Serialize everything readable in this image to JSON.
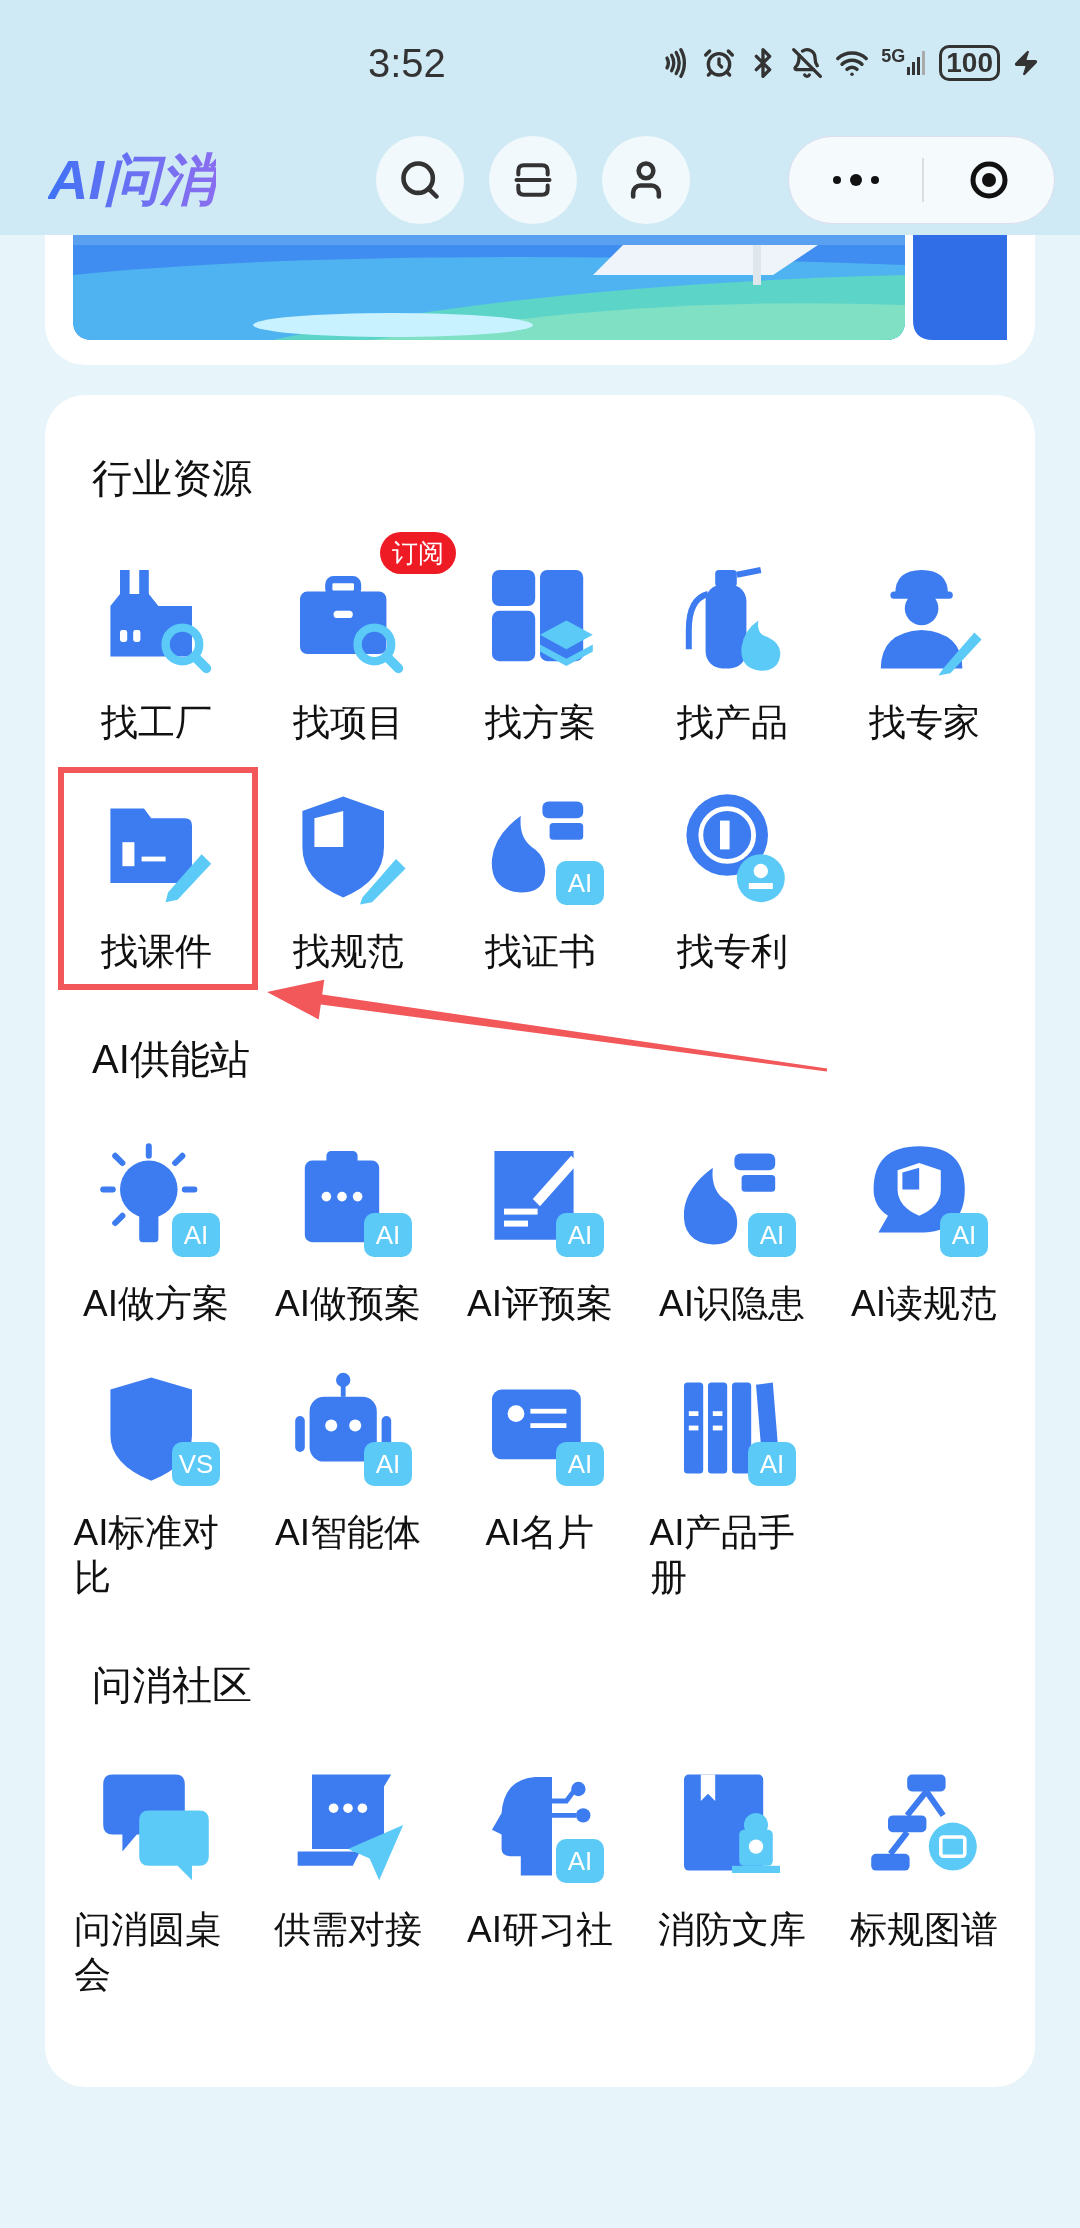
{
  "status_bar": {
    "time": "3:52",
    "network": "5G",
    "battery": "100"
  },
  "header": {
    "logo": "AI问消"
  },
  "sections": [
    {
      "title": "行业资源",
      "items": [
        {
          "label": "找工厂",
          "highlighted": false
        },
        {
          "label": "找项目",
          "badge": "订阅",
          "highlighted": false
        },
        {
          "label": "找方案",
          "highlighted": false
        },
        {
          "label": "找产品",
          "highlighted": false
        },
        {
          "label": "找专家",
          "highlighted": false
        },
        {
          "label": "找课件",
          "highlighted": true
        },
        {
          "label": "找规范",
          "highlighted": false
        },
        {
          "label": "找证书",
          "tag": "AI",
          "highlighted": false
        },
        {
          "label": "找专利",
          "highlighted": false
        }
      ]
    },
    {
      "title": "AI供能站",
      "items": [
        {
          "label": "AI做方案",
          "tag": "AI",
          "highlighted": false
        },
        {
          "label": "AI做预案",
          "tag": "AI",
          "highlighted": false
        },
        {
          "label": "AI评预案",
          "tag": "AI",
          "highlighted": false
        },
        {
          "label": "AI识隐患",
          "tag": "AI",
          "highlighted": false
        },
        {
          "label": "AI读规范",
          "tag": "AI",
          "highlighted": false
        },
        {
          "label": "AI标准对比",
          "tag": "VS",
          "highlighted": false
        },
        {
          "label": "AI智能体",
          "tag": "AI",
          "highlighted": false
        },
        {
          "label": "AI名片",
          "tag": "AI",
          "highlighted": false
        },
        {
          "label": "AI产品手册",
          "tag": "AI",
          "highlighted": false
        }
      ]
    },
    {
      "title": "问消社区",
      "items": [
        {
          "label": "问消圆桌会",
          "highlighted": false
        },
        {
          "label": "供需对接",
          "highlighted": false
        },
        {
          "label": "AI研习社",
          "tag": "AI",
          "highlighted": false
        },
        {
          "label": "消防文库",
          "highlighted": false
        },
        {
          "label": "标规图谱",
          "highlighted": false
        }
      ]
    }
  ]
}
